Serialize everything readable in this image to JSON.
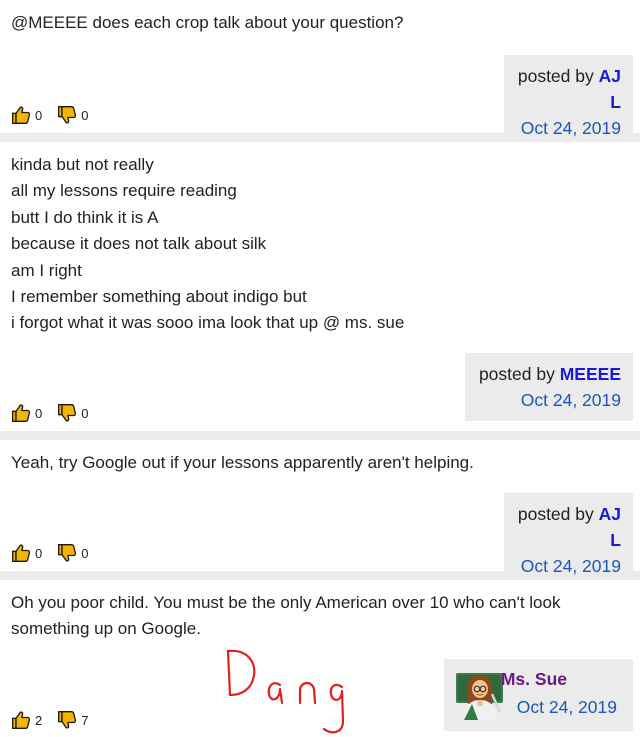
{
  "posts": [
    {
      "lines": [
        "@MEEEE does each crop talk about your question?"
      ],
      "posted_by_label": "posted by",
      "author": "AJ L",
      "date": "Oct 24, 2019",
      "likes": "0",
      "dislikes": "0"
    },
    {
      "lines": [
        "kinda but not really",
        "all my lessons require reading",
        "butt I do think it is A",
        "because it does not talk about silk",
        "am I right",
        "I remember something about indigo but",
        "i forgot what it was sooo ima look that up @ ms. sue"
      ],
      "posted_by_label": "posted by",
      "author": "MEEEE",
      "date": "Oct 24, 2019",
      "likes": "0",
      "dislikes": "0"
    },
    {
      "lines": [
        "Yeah, try Google out if your lessons apparently aren't helping."
      ],
      "posted_by_label": "posted by",
      "author": "AJ L",
      "date": "Oct 24, 2019",
      "likes": "0",
      "dislikes": "0"
    },
    {
      "lines": [
        "Oh you poor child. You must be the only American over 10 who can't look",
        "something up on Google."
      ],
      "author": "Ms. Sue",
      "date": "Oct 24, 2019",
      "likes": "2",
      "dislikes": "7",
      "handwritten": "Dang"
    }
  ],
  "icons": {
    "like": "thumbs-up-icon",
    "dislike": "thumbs-down-icon",
    "avatar": "teacher-avatar-icon"
  },
  "colors": {
    "thumb_fill": "#f5b400",
    "author_link": "#1a1ad6",
    "date_link": "#1a57b8",
    "ms_sue": "#6a1a86",
    "scribble": "#e0201c"
  }
}
